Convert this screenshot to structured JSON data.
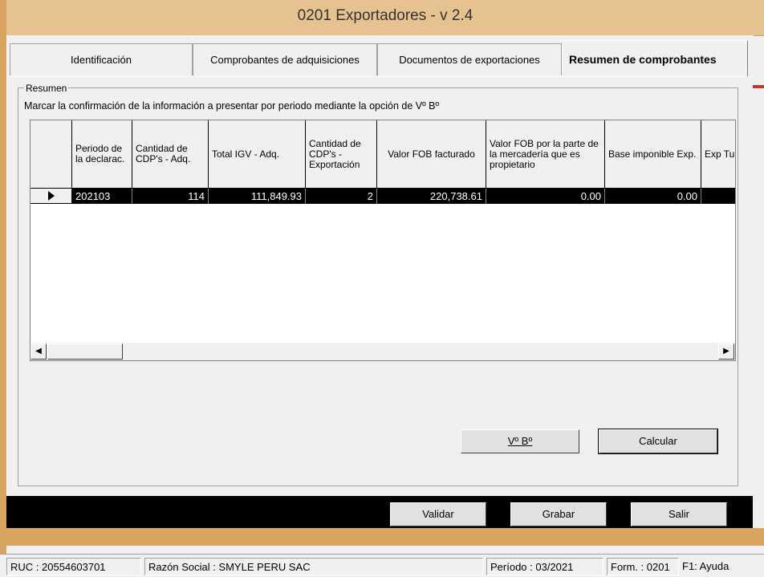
{
  "window": {
    "title": "0201 Exportadores - v 2.4"
  },
  "tabs": [
    {
      "label": "Identificación"
    },
    {
      "label": "Comprobantes de adquisiciones"
    },
    {
      "label": "Documentos de exportaciones"
    },
    {
      "label": "Resumen de comprobantes"
    }
  ],
  "resumen": {
    "group_label": "Resumen",
    "instruction": "Marcar la confirmación de la información a presentar por periodo mediante la opción de  Vº Bº"
  },
  "grid": {
    "headers": [
      "Periodo de la declarac.",
      "Cantidad de CDP's - Adq.",
      "Total IGV - Adq.",
      "Cantidad de CDP's - Exportación",
      "Valor FOB facturado",
      "Valor FOB por la parte de la mercadería que es propietario",
      "Base imponible Exp.",
      "Exp Tur"
    ],
    "rows": [
      {
        "periodo": "202103",
        "cant_adq": "114",
        "total_igv": "111,849.93",
        "cant_exp": "2",
        "valor_fob": "220,738.61",
        "valor_fob_prop": "0.00",
        "base_imp": "0.00",
        "exp_tur": ""
      }
    ]
  },
  "buttons": {
    "vobo": "Vº Bº",
    "calcular": "Calcular",
    "validar": "Validar",
    "grabar": "Grabar",
    "salir": "Salir"
  },
  "status": {
    "ruc": "RUC : 20554603701",
    "razon_social": "Razón Social : SMYLE PERU SAC",
    "periodo": "Período : 03/2021",
    "form": "Form. : 0201",
    "ayuda": "F1: Ayuda"
  }
}
